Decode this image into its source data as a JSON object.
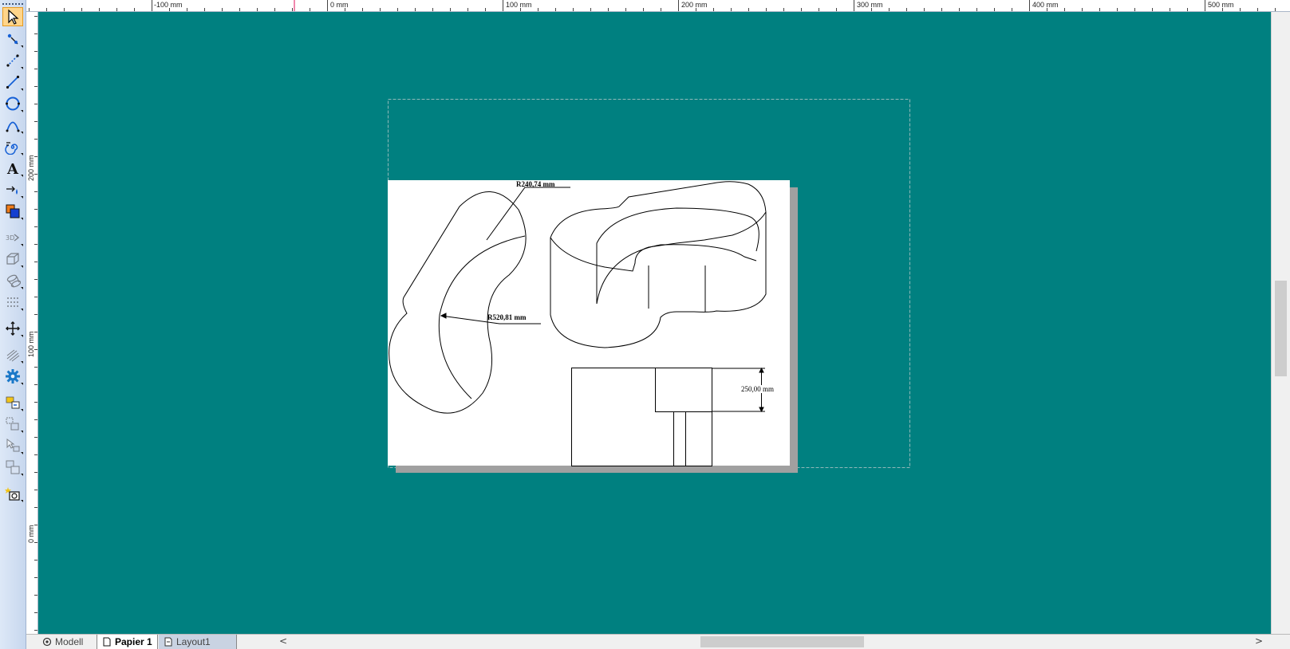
{
  "toolbar": {
    "tools": [
      {
        "name": "select-tool",
        "active": true
      },
      {
        "name": "point-tool"
      },
      {
        "name": "dotted-line-tool"
      },
      {
        "name": "line-tool"
      },
      {
        "name": "circle-tool"
      },
      {
        "name": "curve-tool"
      },
      {
        "name": "spiral-tool"
      },
      {
        "name": "text-tool"
      },
      {
        "name": "dimension-tool"
      },
      {
        "name": "fill-tool"
      },
      {
        "name": "3d-tool",
        "dim": true
      },
      {
        "name": "box-tool",
        "dim": true
      },
      {
        "name": "cylinder-tool",
        "dim": true
      },
      {
        "name": "grid-tool",
        "dim": true
      },
      {
        "name": "move-tool"
      },
      {
        "name": "hatch-tool",
        "dim": true
      },
      {
        "name": "settings-tool"
      },
      {
        "name": "layer-tool"
      },
      {
        "name": "group-tool",
        "dim": true
      },
      {
        "name": "select-object-tool",
        "dim": true
      },
      {
        "name": "arrange-tool",
        "dim": true
      },
      {
        "name": "snapshot-tool"
      }
    ]
  },
  "ruler_top": {
    "labels": [
      "-100 mm",
      "0 mm",
      "100 mm",
      "200 mm",
      "300 mm",
      "400 mm",
      "500 mm"
    ]
  },
  "ruler_left": {
    "labels": [
      "200 mm",
      "100 mm",
      "0 mm"
    ]
  },
  "drawing": {
    "dim_radius_1": "R240,74 mm",
    "dim_radius_2": "R520,81 mm",
    "dim_length": "250,00 mm"
  },
  "tabs": [
    {
      "label": "Modell",
      "icon": "model-icon",
      "active": false
    },
    {
      "label": "Papier 1",
      "icon": "page-icon",
      "active": true
    },
    {
      "label": "Layout1",
      "icon": "layout-icon",
      "active": false
    }
  ],
  "scroll": {
    "left_arrow": "<",
    "right_arrow": ">"
  },
  "colors": {
    "canvas": "#008080",
    "paper": "#ffffff",
    "shadow": "#a0a0a0",
    "active_tool": "#ffd58a"
  }
}
